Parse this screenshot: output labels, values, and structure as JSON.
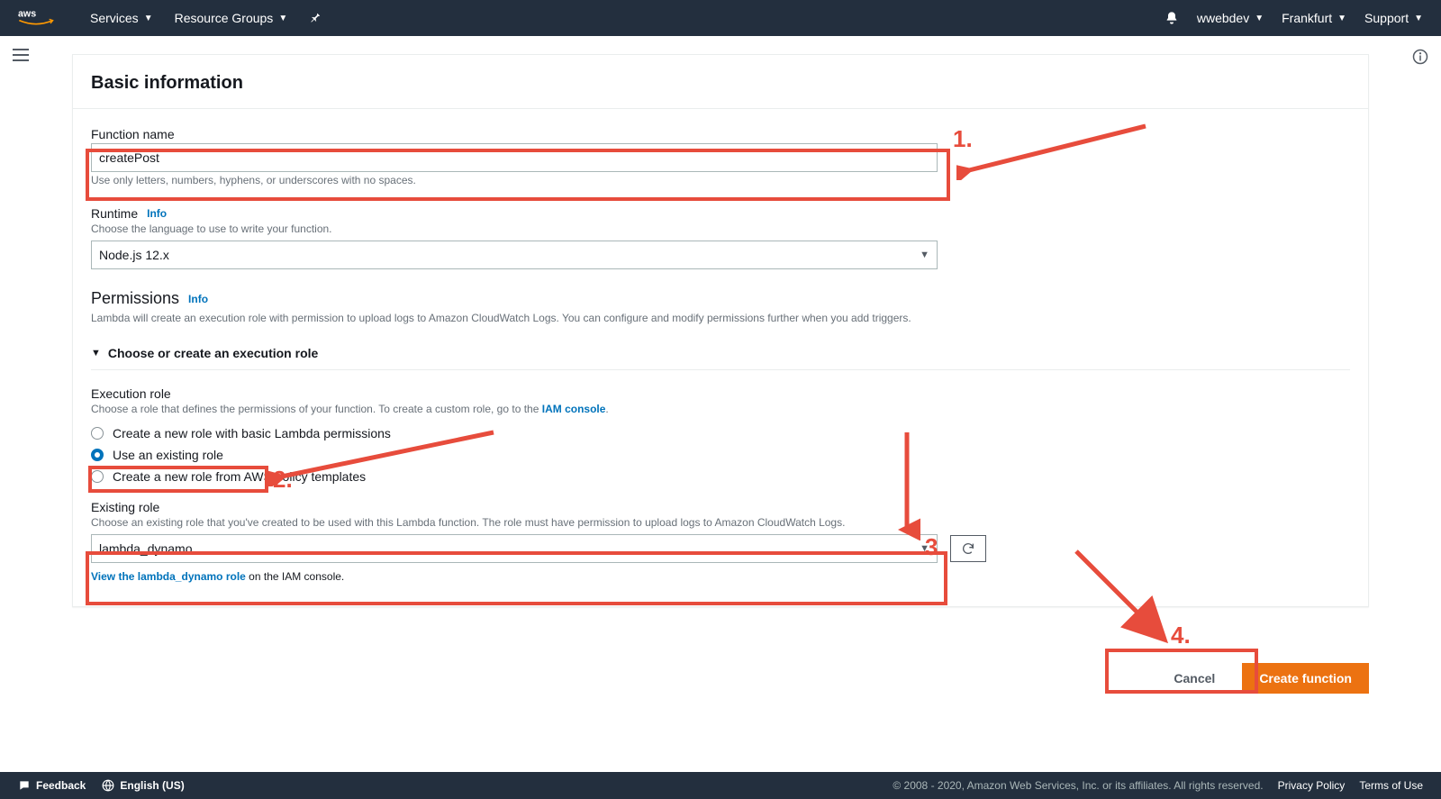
{
  "topbar": {
    "services_label": "Services",
    "resource_groups_label": "Resource Groups",
    "user_label": "wwebdev",
    "region_label": "Frankfurt",
    "support_label": "Support"
  },
  "section": {
    "title": "Basic information"
  },
  "function_name": {
    "label": "Function name",
    "value": "createPost",
    "hint": "Use only letters, numbers, hyphens, or underscores with no spaces."
  },
  "runtime": {
    "label": "Runtime",
    "info": "Info",
    "help": "Choose the language to use to write your function.",
    "value": "Node.js 12.x"
  },
  "permissions": {
    "title": "Permissions",
    "info": "Info",
    "desc": "Lambda will create an execution role with permission to upload logs to Amazon CloudWatch Logs. You can configure and modify permissions further when you add triggers.",
    "expand_label": "Choose or create an execution role"
  },
  "exec_role": {
    "label": "Execution role",
    "help_prefix": "Choose a role that defines the permissions of your function. To create a custom role, go to the ",
    "iam_link": "IAM console",
    "help_suffix": ".",
    "options": {
      "o1": "Create a new role with basic Lambda permissions",
      "o2": "Use an existing role",
      "o3": "Create a new role from AWS policy templates"
    }
  },
  "existing_role": {
    "label": "Existing role",
    "help": "Choose an existing role that you've created to be used with this Lambda function. The role must have permission to upload logs to Amazon CloudWatch Logs.",
    "value": "lambda_dynamo",
    "view_link": "View the lambda_dynamo role",
    "view_suffix": " on the IAM console."
  },
  "actions": {
    "cancel": "Cancel",
    "create": "Create function"
  },
  "footer": {
    "feedback": "Feedback",
    "language": "English (US)",
    "copyright": "© 2008 - 2020, Amazon Web Services, Inc. or its affiliates. All rights reserved.",
    "privacy": "Privacy Policy",
    "terms": "Terms of Use"
  },
  "annotations": {
    "a1": "1.",
    "a2": "2.",
    "a3": "3.",
    "a4": "4."
  }
}
